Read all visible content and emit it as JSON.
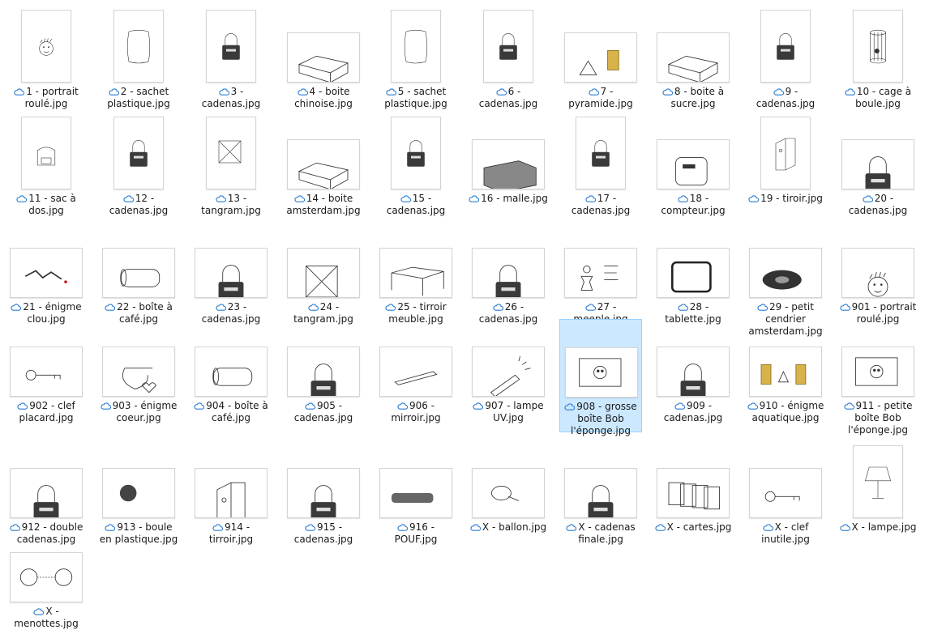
{
  "files": [
    {
      "name": "1 - portrait roulé.jpg",
      "icon": "portrait-sketch",
      "orient": "port"
    },
    {
      "name": "2 - sachet plastique.jpg",
      "icon": "bag-sketch",
      "orient": "port"
    },
    {
      "name": "3 - cadenas.jpg",
      "icon": "padlock-sketch",
      "orient": "port"
    },
    {
      "name": "4 - boite chinoise.jpg",
      "icon": "box-sketch",
      "orient": "land"
    },
    {
      "name": "5 - sachet plastique.jpg",
      "icon": "bag-sketch",
      "orient": "port"
    },
    {
      "name": "6 - cadenas.jpg",
      "icon": "padlock-sketch",
      "orient": "port"
    },
    {
      "name": "7 - pyramide.jpg",
      "icon": "pyramid-sketch",
      "orient": "land"
    },
    {
      "name": "8 - boite à sucre.jpg",
      "icon": "box-sketch",
      "orient": "land"
    },
    {
      "name": "9 - cadenas.jpg",
      "icon": "padlock-sketch",
      "orient": "port"
    },
    {
      "name": "10 - cage à boule.jpg",
      "icon": "cage-sketch",
      "orient": "port"
    },
    {
      "name": "11 - sac à dos.jpg",
      "icon": "backpack-sketch",
      "orient": "port"
    },
    {
      "name": "12 - cadenas.jpg",
      "icon": "padlock-sketch",
      "orient": "port"
    },
    {
      "name": "13 - tangram.jpg",
      "icon": "tangram-sketch",
      "orient": "port"
    },
    {
      "name": "14 - boite amsterdam.jpg",
      "icon": "box-sketch",
      "orient": "land"
    },
    {
      "name": "15 - cadenas.jpg",
      "icon": "padlock-sketch",
      "orient": "port"
    },
    {
      "name": "16 - malle.jpg",
      "icon": "trunk-sketch",
      "orient": "land"
    },
    {
      "name": "17 - cadenas.jpg",
      "icon": "padlock-sketch",
      "orient": "port"
    },
    {
      "name": "18 - compteur.jpg",
      "icon": "counter-sketch",
      "orient": "land"
    },
    {
      "name": "19 - tiroir.jpg",
      "icon": "drawer-sketch",
      "orient": "port"
    },
    {
      "name": "20 - cadenas.jpg",
      "icon": "padlock-sketch",
      "orient": "land"
    },
    {
      "name": "21 - énigme clou.jpg",
      "icon": "nail-sketch",
      "orient": "land"
    },
    {
      "name": "22 - boîte à café.jpg",
      "icon": "tube-sketch",
      "orient": "land"
    },
    {
      "name": "23 - cadenas.jpg",
      "icon": "padlock-sketch",
      "orient": "land"
    },
    {
      "name": "24 - tangram.jpg",
      "icon": "tangram-sketch",
      "orient": "land"
    },
    {
      "name": "25 - tirroir meuble.jpg",
      "icon": "table-sketch",
      "orient": "land"
    },
    {
      "name": "26 - cadenas.jpg",
      "icon": "padlock-sketch",
      "orient": "land"
    },
    {
      "name": "27 - meeple.jpg",
      "icon": "meeple-sketch",
      "orient": "land"
    },
    {
      "name": "28 - tablette.jpg",
      "icon": "tablet-sketch",
      "orient": "land"
    },
    {
      "name": "29 - petit cendrier amsterdam.jpg",
      "icon": "ashtray-sketch",
      "orient": "land"
    },
    {
      "name": "901 - portrait roulé.jpg",
      "icon": "portrait-sketch",
      "orient": "land"
    },
    {
      "name": "902 - clef placard.jpg",
      "icon": "key-sketch",
      "orient": "land"
    },
    {
      "name": "903 - énigme coeur.jpg",
      "icon": "heart-sketch",
      "orient": "land"
    },
    {
      "name": "904 - boîte à café.jpg",
      "icon": "tube-sketch",
      "orient": "land"
    },
    {
      "name": "905 - cadenas.jpg",
      "icon": "padlock-sketch",
      "orient": "land"
    },
    {
      "name": "906 - mirroir.jpg",
      "icon": "mirror-sketch",
      "orient": "land"
    },
    {
      "name": "907 - lampe UV.jpg",
      "icon": "uv-lamp-sketch",
      "orient": "land"
    },
    {
      "name": "908 - grosse boîte Bob l'éponge.jpg",
      "icon": "bob-box-sketch",
      "orient": "land",
      "selected": true
    },
    {
      "name": "909 - cadenas.jpg",
      "icon": "padlock-sketch",
      "orient": "land"
    },
    {
      "name": "910 - énigme aquatique.jpg",
      "icon": "aquatic-sketch",
      "orient": "land"
    },
    {
      "name": "911 - petite boîte Bob l'éponge.jpg",
      "icon": "bob-box-sketch",
      "orient": "land"
    },
    {
      "name": "912 - double cadenas.jpg",
      "icon": "padlock-sketch",
      "orient": "land"
    },
    {
      "name": "913 - boule en plastique.jpg",
      "icon": "ball-sketch",
      "orient": "land"
    },
    {
      "name": "914 - tirroir.jpg",
      "icon": "drawer-sketch",
      "orient": "land"
    },
    {
      "name": "915 - cadenas.jpg",
      "icon": "padlock-sketch",
      "orient": "land"
    },
    {
      "name": "916 - POUF.jpg",
      "icon": "pouf-sketch",
      "orient": "land"
    },
    {
      "name": "X - ballon.jpg",
      "icon": "balloon-sketch",
      "orient": "land"
    },
    {
      "name": "X - cadenas finale.jpg",
      "icon": "padlock-sketch",
      "orient": "land"
    },
    {
      "name": "X - cartes.jpg",
      "icon": "cards-sketch",
      "orient": "land"
    },
    {
      "name": "X - clef inutile.jpg",
      "icon": "key-sketch",
      "orient": "land"
    },
    {
      "name": "X - lampe.jpg",
      "icon": "lamp-sketch",
      "orient": "port"
    },
    {
      "name": "X - menottes.jpg",
      "icon": "handcuffs-sketch",
      "orient": "land"
    }
  ],
  "cloud_status_icon": "cloud-icon",
  "colors": {
    "selection_bg": "#cce8ff",
    "selection_border": "#99d1ff",
    "cloud": "#2b7cd3"
  }
}
